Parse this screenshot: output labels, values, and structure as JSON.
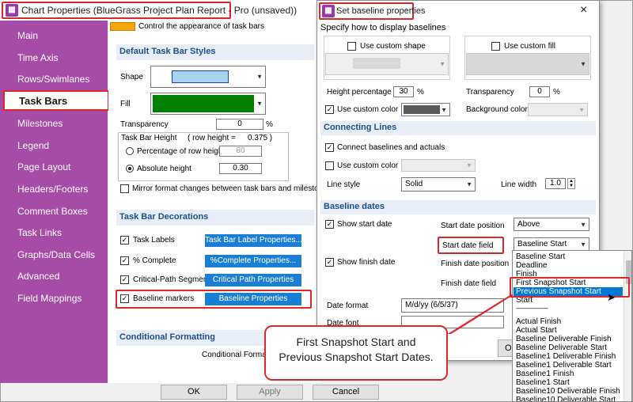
{
  "main_window": {
    "title": "Chart Properties (BlueGrass Project Plan Report - Pro (unsaved))"
  },
  "sidebar": {
    "items": [
      {
        "label": "Main"
      },
      {
        "label": "Time Axis"
      },
      {
        "label": "Rows/Swimlanes"
      },
      {
        "label": "Task Bars"
      },
      {
        "label": "Milestones"
      },
      {
        "label": "Legend"
      },
      {
        "label": "Page Layout"
      },
      {
        "label": "Headers/Footers"
      },
      {
        "label": "Comment Boxes"
      },
      {
        "label": "Task Links"
      },
      {
        "label": "Graphs/Data Cells"
      },
      {
        "label": "Advanced"
      },
      {
        "label": "Field Mappings"
      }
    ],
    "active": "Task Bars"
  },
  "content": {
    "intro": "Control the appearance of task bars",
    "default_styles": {
      "header": "Default Task Bar Styles",
      "shape_label": "Shape",
      "fill_label": "Fill",
      "transparency_label": "Transparency",
      "transparency_value": "0",
      "transparency_unit": "%",
      "height_group_label": "Task Bar Height",
      "row_height_note": "( row height =",
      "row_height_value": "0.375 )",
      "pct_row_height_label": "Percentage of row height",
      "pct_row_height_value": "80",
      "absolute_height_label": "Absolute height",
      "absolute_height_value": "0.30",
      "mirror_label": "Mirror format changes between task bars and milestones",
      "shape_color": "#a8d4ee",
      "fill_color": "#008000"
    },
    "decorations": {
      "header": "Task Bar Decorations",
      "rows": [
        {
          "label": "Task Labels",
          "button": "Task Bar Label Properties..."
        },
        {
          "label": "% Complete",
          "button": "%Complete Properties..."
        },
        {
          "label": "Critical-Path Segments",
          "button": "Critical Path Properties"
        },
        {
          "label": "Baseline markers",
          "button": "Baseline Properties"
        }
      ]
    },
    "conditional": {
      "header": "Conditional Formatting",
      "label": "Conditional Formatting"
    }
  },
  "bottom_bar": {
    "ok": "OK",
    "apply": "Apply",
    "cancel": "Cancel"
  },
  "dialog": {
    "title": "Set baseline properties",
    "close": "×",
    "subtitle": "Specify how to display baselines",
    "custom_shape_label": "Use custom shape",
    "custom_fill_label": "Use custom fill",
    "height_pct_label": "Height percentage",
    "height_pct_value": "30",
    "height_pct_unit": "%",
    "transparency_label": "Transparency",
    "transparency_value": "0",
    "transparency_unit": "%",
    "custom_color_label": "Use custom color",
    "custom_color_value": "#595959",
    "background_color_label": "Background color",
    "connecting_lines": {
      "header": "Connecting Lines",
      "connect_label": "Connect baselines and actuals",
      "custom_color_label": "Use custom color",
      "line_style_label": "Line style",
      "line_style_value": "Solid",
      "line_width_label": "Line width",
      "line_width_value": "1.0"
    },
    "baseline_dates": {
      "header": "Baseline dates",
      "show_start_label": "Show start date",
      "start_position_label": "Start date position",
      "start_position_value": "Above",
      "start_field_label": "Start date field",
      "start_field_value": "Baseline Start",
      "show_finish_label": "Show finish date",
      "finish_position_label": "Finish date position",
      "finish_field_label": "Finish date field",
      "date_format_label": "Date format",
      "date_format_value": "M/d/yy (6/5/37)",
      "date_font_label": "Date font",
      "ok_partial": "Ok"
    }
  },
  "dropdown": {
    "items": [
      "Baseline Start",
      "Deadline",
      "Finish",
      "First Snapshot Start",
      "Previous Snapshot Start",
      "Start",
      "------------------------------",
      "Actual Finish",
      "Actual Start",
      "Baseline Deliverable Finish",
      "Baseline Deliverable Start",
      "Baseline1 Deliverable Finish",
      "Baseline1 Deliverable Start",
      "Baseline1 Finish",
      "Baseline1 Start",
      "Baseline10 Deliverable Finish",
      "Baseline10 Deliverable Start"
    ],
    "selected": "Previous Snapshot Start",
    "highlight_color": "#0078d7"
  },
  "callout": {
    "line1": "First Snapshot Start and",
    "line2": "Previous Snapshot Start Dates."
  },
  "colors": {
    "sidebar": "#a64ca6",
    "accent_red": "#e0262d",
    "button_blue": "#1a7fd4",
    "section_text": "#1f4e8c"
  }
}
